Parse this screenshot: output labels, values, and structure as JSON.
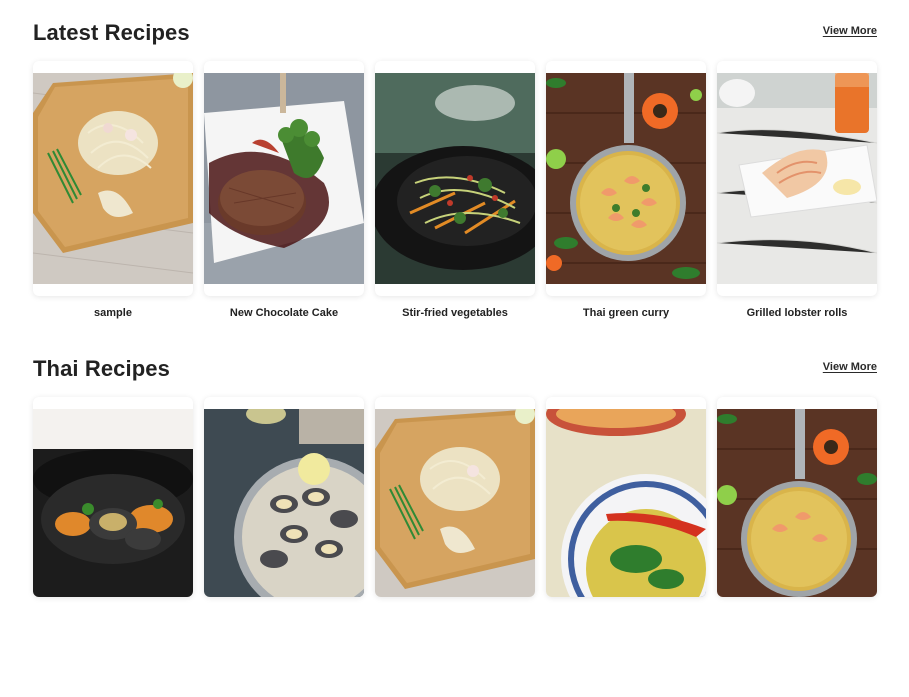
{
  "sections": [
    {
      "title": "Latest Recipes",
      "view_more": "View More",
      "recipes": [
        {
          "name": "sample",
          "image_icon": "noodle-salad-image"
        },
        {
          "name": "New Chocolate Cake",
          "image_icon": "steak-image"
        },
        {
          "name": "Stir-fried vegetables",
          "image_icon": "stir-fry-image"
        },
        {
          "name": "Thai green curry",
          "image_icon": "shrimp-curry-image"
        },
        {
          "name": "Grilled lobster rolls",
          "image_icon": "lobster-plate-image"
        }
      ]
    },
    {
      "title": "Thai Recipes",
      "view_more": "View More",
      "recipes": [
        {
          "name": "",
          "image_icon": "mussels-pot-image"
        },
        {
          "name": "",
          "image_icon": "clams-pan-image"
        },
        {
          "name": "",
          "image_icon": "noodle-salad-image"
        },
        {
          "name": "",
          "image_icon": "soup-bowl-image"
        },
        {
          "name": "",
          "image_icon": "shrimp-curry-image"
        }
      ]
    }
  ],
  "colors": {
    "heading": "#222222",
    "card_shadow": "#e6e6e6",
    "background": "#ffffff"
  }
}
